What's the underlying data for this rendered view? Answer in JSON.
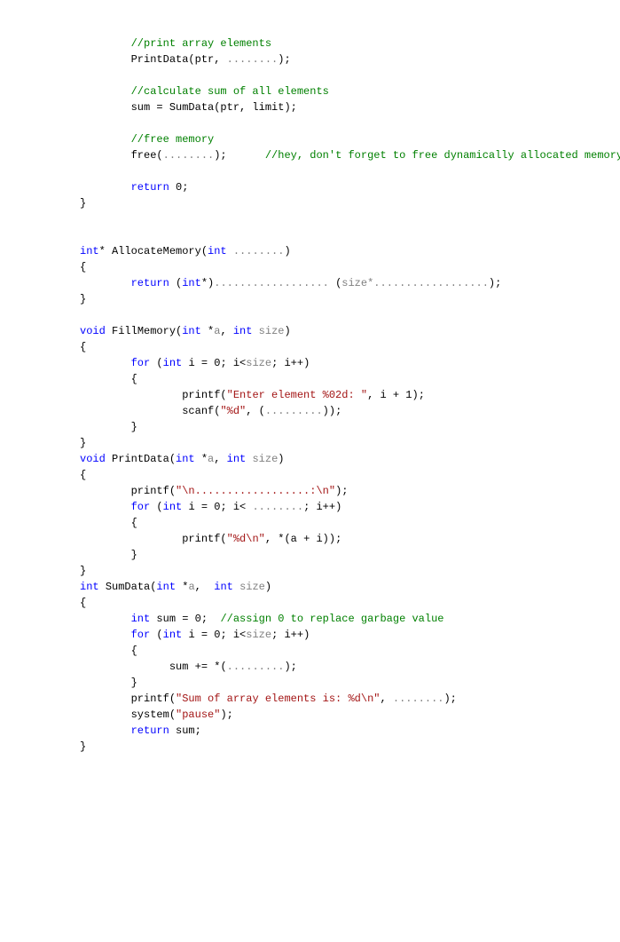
{
  "lines": {
    "0": "//print array elements",
    "1a": "PrintData(ptr,",
    "1b": "........",
    "1c": ");",
    "2": "//calculate sum of all elements",
    "3": "sum = SumData(ptr, limit);",
    "4": "//free memory",
    "5a": "free(",
    "5b": "........",
    "5c": ");",
    "5d": "//hey, don't forget to free dynamically allocated memory.",
    "6a": "return",
    "6b": "0;",
    "7": "}",
    "8a": "int",
    "8b": "* AllocateMemory(",
    "8c": "int",
    "8d": "........",
    "8e": ")",
    "9": "{",
    "10a": "return",
    "10b": "(",
    "10c": "int",
    "10d": "*)",
    "10e": "..................",
    "10f": "(",
    "10g": "size*..................",
    "10h": ");",
    "11": "}",
    "12a": "void",
    "12b": "FillMemory(",
    "12c": "int",
    "12d": "*",
    "12e": "a",
    "12f": ",",
    "12g": "int",
    "12h": "size",
    "12i": ")",
    "13": "{",
    "14a": "for",
    "14b": "(",
    "14c": "int",
    "14d": "i = 0; i<",
    "14e": "size",
    "14f": "; i++)",
    "15": "{",
    "16a": "printf(",
    "16b": "\"Enter element %02d: \"",
    "16c": ", i + 1);",
    "17a": "scanf(",
    "17b": "\"%d\"",
    "17c": ", (",
    "17d": ".........",
    "17e": "));",
    "18": "}",
    "19": "}",
    "20a": "void",
    "20b": "PrintData(",
    "20c": "int",
    "20d": "*",
    "20e": "a",
    "20f": ",",
    "20g": "int",
    "20h": "size",
    "20i": ")",
    "21": "{",
    "22a": "printf(",
    "22b": "\"\\n..................:\\n\"",
    "22c": ");",
    "23a": "for",
    "23b": "(",
    "23c": "int",
    "23d": "i = 0; i<",
    "23e": "........",
    "23f": "; i++)",
    "24": "{",
    "25a": "printf(",
    "25b": "\"%d\\n\"",
    "25c": ", *(a + i));",
    "26": "}",
    "27": "}",
    "28a": "int",
    "28b": "SumData(",
    "28c": "int",
    "28d": "*",
    "28e": "a",
    "28f": ",",
    "28g": "int",
    "28h": "size",
    "28i": ")",
    "29": "{",
    "30a": "int",
    "30b": "sum = 0;",
    "30c": "//assign 0 to replace garbage value",
    "31a": "for",
    "31b": "(",
    "31c": "int",
    "31d": "i = 0; i<",
    "31e": "size",
    "31f": "; i++)",
    "32": "{",
    "33a": "sum += *(",
    "33b": ".........",
    "33c": ");",
    "34": "}",
    "35a": "printf(",
    "35b": "\"Sum of array elements is: %d\\n\"",
    "35c": ",",
    "35d": "........",
    "35e": ");",
    "36a": "system(",
    "36b": "\"pause\"",
    "36c": ");",
    "37a": "return",
    "37b": "sum;",
    "38": "}"
  }
}
